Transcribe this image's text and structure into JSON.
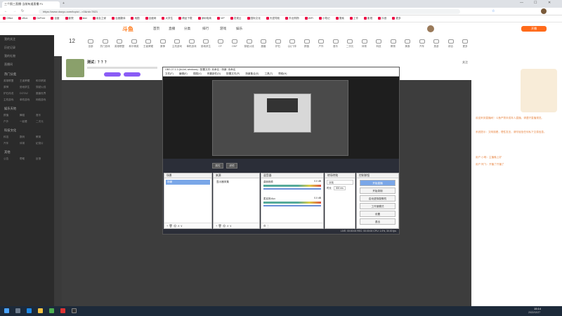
{
  "browser": {
    "tab_title": "三个照三直播·当前有道直播 F1",
    "url": "https://www.douyu.com/topic/...=0&rid=7821",
    "bookmarks": [
      "Office",
      "cBox",
      "DeFree",
      "百度",
      "影院",
      "kiwi",
      "亲友之家",
      "百度翻译",
      "地图",
      "百度网",
      "大学生",
      "精品下载",
      "深圳电商",
      "VIP",
      "发现云",
      "国际文化",
      "天涯导航",
      "外出购物",
      "WiFi",
      "小笔记",
      "搜索",
      "工作",
      "影视",
      "抖音",
      "更多"
    ]
  },
  "site": {
    "logo": "斗鱼",
    "nav": [
      "首页",
      "直播",
      "分类",
      "排行",
      "游戏",
      "娱乐"
    ],
    "icons": [
      "全部",
      "热门游戏",
      "英雄联盟",
      "和平精英",
      "王者荣耀",
      "原神",
      "主机游戏",
      "单机游戏",
      "绝地求生",
      "CF",
      "DNF",
      "穿越火线",
      "魔兽",
      "炉石",
      "QQ飞车",
      "颜值",
      "户外",
      "音乐",
      "二次元",
      "体育",
      "科技",
      "教育",
      "美食",
      "汽车",
      "旅游",
      "综合",
      "更多"
    ],
    "live_button": "开播",
    "channel_name": "测试：？？？",
    "room_badge": "LIVE",
    "follow": "关注"
  },
  "sidebar": {
    "top": [
      "我的关注",
      "历史记录",
      "我的礼物",
      "直播间"
    ],
    "sections": [
      {
        "title": "热门分类",
        "items": [
          "英雄联盟",
          "王者荣耀",
          "和平精英",
          "原神",
          "绝地求生",
          "穿越火线",
          "炉石传说",
          "DOTA2",
          "魔兽世界",
          "主机游戏",
          "单机游戏",
          "网络游戏"
        ]
      },
      {
        "title": "娱乐天地",
        "items": [
          "颜值",
          "舞蹈",
          "音乐",
          "户外",
          "一起看",
          "二次元"
        ]
      },
      {
        "title": "科技文化",
        "items": [
          "科技",
          "数码",
          "教育",
          "汽车",
          "体育",
          "纪录片"
        ]
      },
      {
        "title": "其他",
        "items": [
          "公告",
          "帮助",
          "反馈"
        ]
      }
    ]
  },
  "chat": [
    "欢迎来到直播间！斗鱼严禁未成年人直播，请遵守直播规范。",
    "系统提示：文明观看，理性发言，请勿轻信任何私下交易信息。",
    "用户 小明：主播晚上好",
    "用户 阿飞：开播了开播了"
  ],
  "obs": {
    "title": "OBS 27.1.3 (64-bit, windows) - 配置文件: 未命名 - 场景: 未命名",
    "menu": [
      "文件(F)",
      "编辑(E)",
      "视图(V)",
      "停靠部件(D)",
      "配置文件(P)",
      "场景集合(S)",
      "工具(T)",
      "帮助(H)"
    ],
    "tabs": [
      "混音器",
      "属性",
      "滤镜"
    ],
    "docks": {
      "scenes": {
        "title": "场景",
        "items": [
          "场景"
        ]
      },
      "sources": {
        "title": "来源",
        "items": [
          "显示器采集"
        ]
      },
      "mixer": {
        "title": "混音器",
        "tracks": [
          {
            "name": "桌面音频",
            "db": "0.0 dB"
          },
          {
            "name": "麦克风/Aux",
            "db": "0.0 dB"
          }
        ]
      },
      "transitions": {
        "title": "转场特效",
        "type": "淡化",
        "duration_label": "时长",
        "duration": "300 ms"
      },
      "controls": {
        "title": "控制按钮",
        "buttons": [
          "开始直播",
          "开始录制",
          "启动虚拟摄像机",
          "工作室模式",
          "设置",
          "退出"
        ]
      }
    },
    "status": "LIVE: 00:00:00   REC: 00:00:00   CPU: 1.0%, 30.00 fps"
  },
  "taskbar": {
    "time": "15:14",
    "date": "2022/12/27"
  }
}
